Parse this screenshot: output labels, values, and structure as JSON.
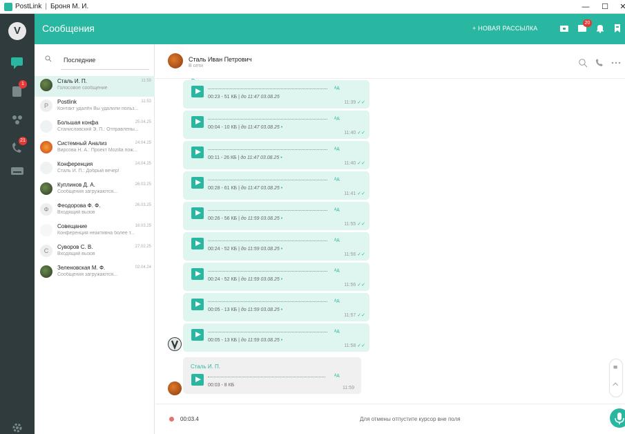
{
  "window": {
    "app_name": "PostLink",
    "user": "Броня М. И.",
    "separator": "|",
    "minimize": "—",
    "maximize": "☐",
    "close": "✕"
  },
  "colors": {
    "accent": "#2ab7a2",
    "rail": "#2f3b3d",
    "badge": "#e53935",
    "bubble_out": "#def6ef",
    "bubble_in": "#f0f0f0"
  },
  "rail": {
    "logo": "V",
    "badges": {
      "contacts": "1",
      "calls": "21"
    }
  },
  "header": {
    "title": "Сообщения",
    "new_mailing": "+ НОВАЯ РАССЫЛКА",
    "notifications_badge": "20"
  },
  "search": {
    "placeholder": "Последние"
  },
  "chats": [
    {
      "name": "Сталь И. П.",
      "time": "11:59",
      "preview": "Голосовое сообщение",
      "avatar": "photo",
      "active": true
    },
    {
      "name": "Postlink",
      "time": "11:53",
      "preview": "Контакт удалён Вы удалили польз...",
      "avatar": "P"
    },
    {
      "name": "Большая конфа",
      "time": "25.04.25",
      "preview": "Станиславский Э. П.: Отправлены...",
      "avatar": "group"
    },
    {
      "name": "Системный Анализ",
      "time": "24.04.25",
      "preview": "Вирсова Н. А.: Проект Mozilla пож...",
      "avatar": "logo"
    },
    {
      "name": "Конференция",
      "time": "24.04.25",
      "preview": "Сталь И. П.: Добрый вечер!",
      "avatar": "group"
    },
    {
      "name": "Куплинов Д. А.",
      "time": "26.03.25",
      "preview": "Сообщения загружаются...",
      "avatar": "photo"
    },
    {
      "name": "Феодорова Ф. Ф.",
      "time": "26.03.25",
      "preview": "Входящий вызов",
      "avatar": "Ф"
    },
    {
      "name": "Совещание",
      "time": "18.03.25",
      "preview": "Конференция неактивна более т...",
      "avatar": "sheet"
    },
    {
      "name": "Суворов С. В.",
      "time": "27.02.25",
      "preview": "Входящий вызов",
      "avatar": "С"
    },
    {
      "name": "Зеленовская М. Ф.",
      "time": "02.04.24",
      "preview": "Сообщения загружаются...",
      "avatar": "photo"
    }
  ],
  "conversation": {
    "name": "Сталь Иван Петрович",
    "status": "В сети",
    "you_label": "Вы",
    "messages": [
      {
        "size": "00:23 - 51 КБ",
        "sent": "до 11:47 03.08.25",
        "dot": "",
        "time": "11:39"
      },
      {
        "size": "00:04 - 10 КБ",
        "sent": "до 11:47 03.08.25",
        "dot": "•",
        "time": "11:40"
      },
      {
        "size": "00:11 - 26 КБ",
        "sent": "до 11:47 03.08.25",
        "dot": "•",
        "time": "11:40"
      },
      {
        "size": "00:28 - 61 КБ",
        "sent": "до 11:47 03.08.25",
        "dot": "•",
        "time": "11:41"
      },
      {
        "size": "00:26 - 56 КБ",
        "sent": "до 11:59 03.08.25",
        "dot": "•",
        "time": "11:55"
      },
      {
        "size": "00:24 - 52 КБ",
        "sent": "до 11:59 03.08.25",
        "dot": "•",
        "time": "11:56"
      },
      {
        "size": "00:24 - 52 КБ",
        "sent": "до 11:59 03.08.25",
        "dot": "•",
        "time": "11:56"
      },
      {
        "size": "00:05 - 13 КБ",
        "sent": "до 11:59 03.08.25",
        "dot": "•",
        "time": "11:57"
      },
      {
        "size": "00:05 - 13 КБ",
        "sent": "до 11:59 03.08.25",
        "dot": "•",
        "time": "11:58"
      }
    ],
    "transcribe_label": "ᴬA",
    "read_mark": "✓✓",
    "incoming": {
      "sender": "Сталь И. П.",
      "size": "00:03 - 8 КБ",
      "time": "11:59"
    }
  },
  "composer": {
    "duration": "00:03.4",
    "hint": "Для отмены отпустите курсор вне поля"
  }
}
